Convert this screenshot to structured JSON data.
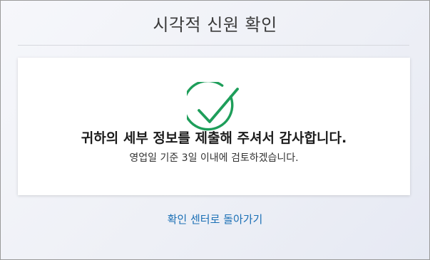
{
  "page": {
    "title": "시각적 신원 확인"
  },
  "card": {
    "icon": "check-circle-icon",
    "headline": "귀하의 세부 정보를 제출해 주셔서 감사합니다.",
    "subline": "영업일 기준 3일 이내에 검토하겠습니다."
  },
  "footer": {
    "back_link": "확인 센터로 돌아가기"
  },
  "colors": {
    "accent_green": "#1e9e5a",
    "link_blue": "#1a6fb5"
  }
}
